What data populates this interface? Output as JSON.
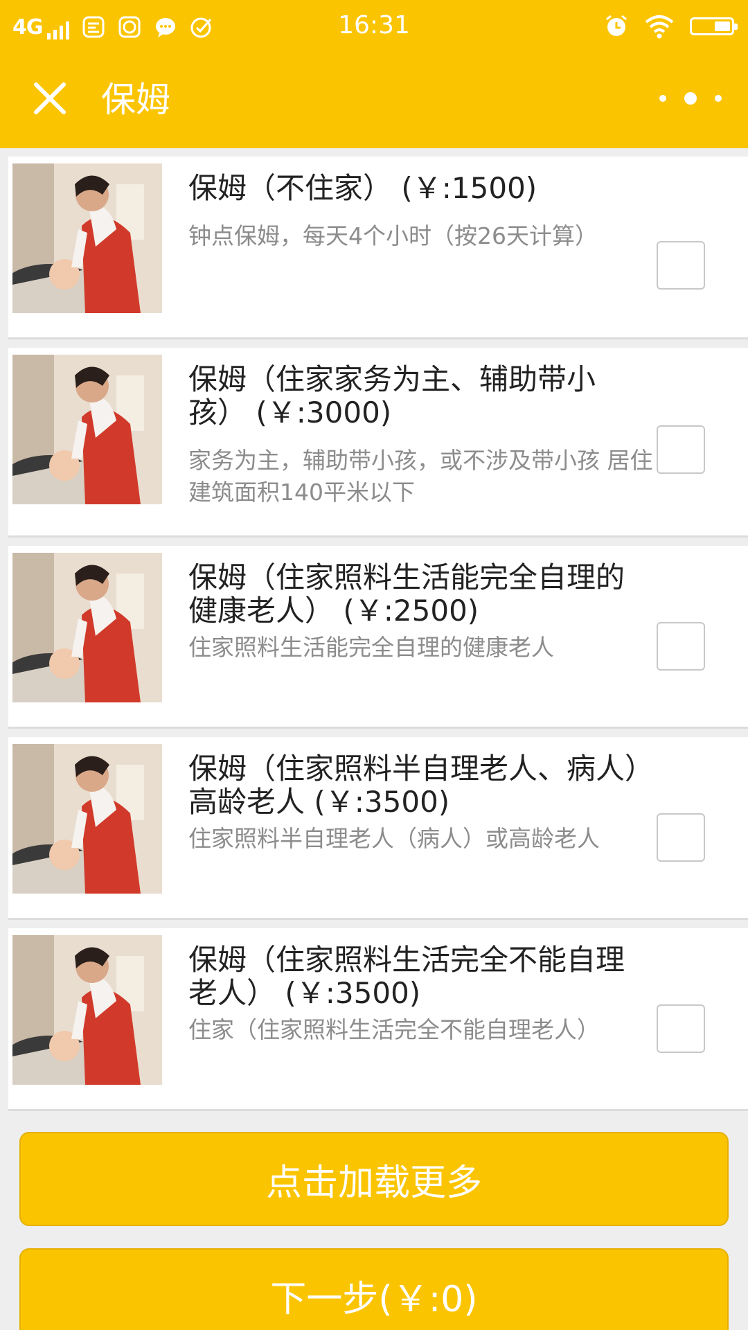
{
  "status_bar": {
    "carrier": "4G",
    "time": "16:31"
  },
  "nav": {
    "title": "保姆"
  },
  "items": [
    {
      "title": "保姆（不住家）",
      "price": "(￥:1500)",
      "desc": "钟点保姆，每天4个小时（按26天计算）",
      "checked": false
    },
    {
      "title": "保姆（住家家务为主、辅助带小孩）",
      "price": "(￥:3000)",
      "desc": "家务为主，辅助带小孩，或不涉及带小孩 居住建筑面积140平米以下",
      "checked": false
    },
    {
      "title": "保姆（住家照料生活能完全自理的健康老人）",
      "price": "(￥:2500)",
      "desc": "住家照料生活能完全自理的健康老人",
      "checked": false
    },
    {
      "title": "保姆（住家照料半自理老人、病人）高龄老人",
      "price": "(￥:3500)",
      "desc": "住家照料半自理老人（病人）或高龄老人",
      "checked": false
    },
    {
      "title": "保姆（住家照料生活完全不能自理老人）",
      "price": "(￥:3500)",
      "desc": "住家（住家照料生活完全不能自理老人）",
      "checked": false
    }
  ],
  "load_more_label": "点击加载更多",
  "next_label": "下一步(￥:0)",
  "colors": {
    "accent": "#fbc400",
    "title_text": "#222222",
    "desc_text": "#8c8c8c"
  }
}
